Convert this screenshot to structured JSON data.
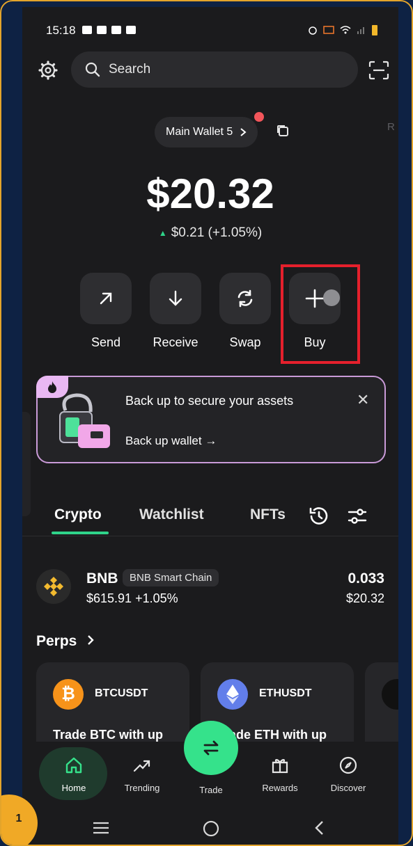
{
  "status_bar": {
    "time": "15:18"
  },
  "search": {
    "placeholder": "Search"
  },
  "wallet": {
    "name": "Main Wallet 5",
    "edge_letter": "R",
    "balance": "$20.32",
    "change": "$0.21 (+1.05%)"
  },
  "actions": [
    {
      "label": "Send",
      "icon": "arrow-up-right-icon"
    },
    {
      "label": "Receive",
      "icon": "arrow-down-icon"
    },
    {
      "label": "Swap",
      "icon": "swap-icon"
    },
    {
      "label": "Buy",
      "icon": "plus-icon"
    }
  ],
  "backup_card": {
    "title": "Back up to secure your assets",
    "link": "Back up wallet →"
  },
  "tabs": [
    "Crypto",
    "Watchlist",
    "NFTs"
  ],
  "assets": [
    {
      "symbol": "BNB",
      "chain": "BNB Smart Chain",
      "price": "$615.91",
      "change": "+1.05%",
      "amount": "0.033",
      "value": "$20.32"
    }
  ],
  "perps": {
    "title": "Perps",
    "cards": [
      {
        "ticker": "BTCUSDT",
        "desc": "Trade BTC with up",
        "icon": "bitcoin-icon",
        "color": "#f7931a"
      },
      {
        "ticker": "ETHUSDT",
        "desc": "Trade ETH with up",
        "icon": "ethereum-icon",
        "color": "#627eea"
      }
    ]
  },
  "nav": [
    "Home",
    "Trending",
    "Trade",
    "Rewards",
    "Discover"
  ],
  "step_badge": "1",
  "colors": {
    "accent": "#35e28b",
    "highlight": "#e5202c",
    "badge": "#f0a926"
  }
}
